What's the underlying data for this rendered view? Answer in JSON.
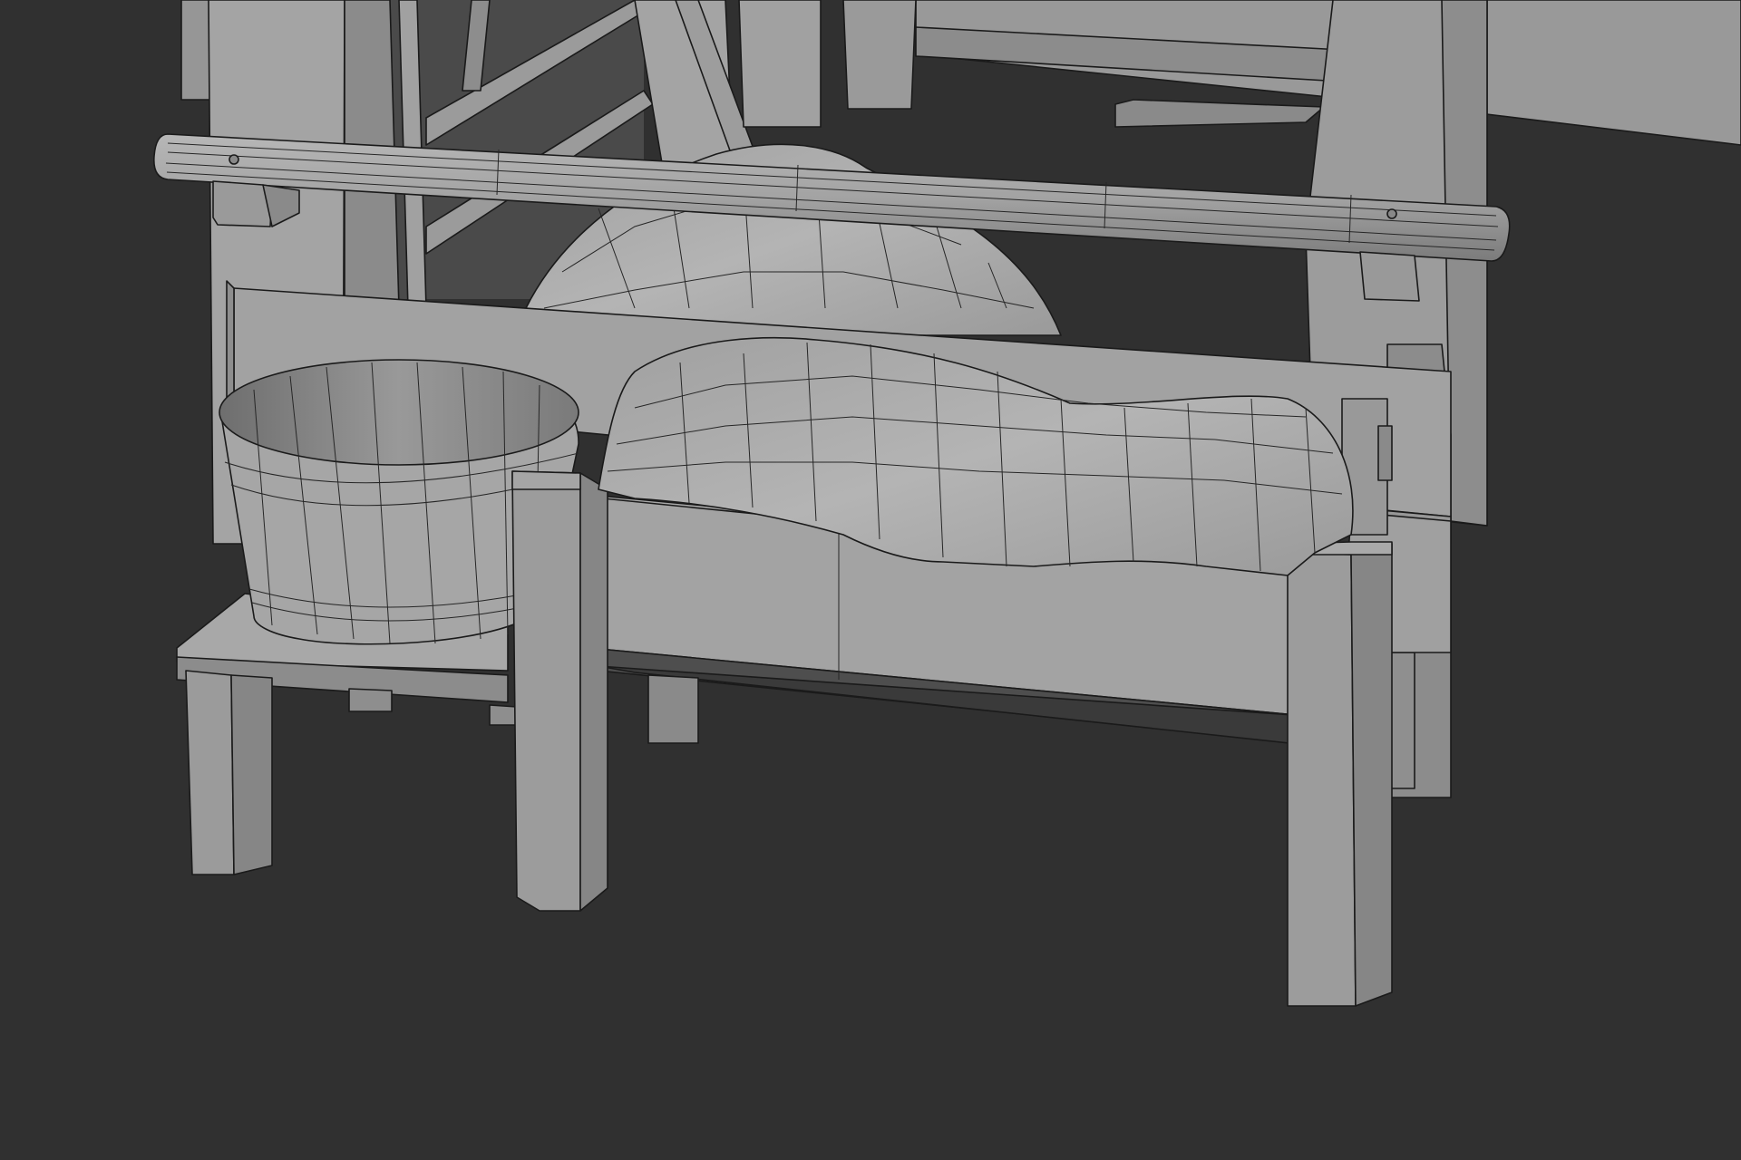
{
  "viewport": {
    "background_color": "#303030",
    "mesh_light": "#a8a8a8",
    "mesh_mid": "#939393",
    "mesh_dark": "#6e6e6e",
    "interior_dark": "#494949",
    "edge_color": "#1a1a1a",
    "shading": "solid-with-wireframe"
  },
  "scene": {
    "objects": [
      "background-wall",
      "back-wooden-frame",
      "horizontal-wooden-rod",
      "sack-back",
      "bench-board",
      "wooden-bucket",
      "small-stool",
      "wooden-trough",
      "sack-in-trough"
    ]
  }
}
